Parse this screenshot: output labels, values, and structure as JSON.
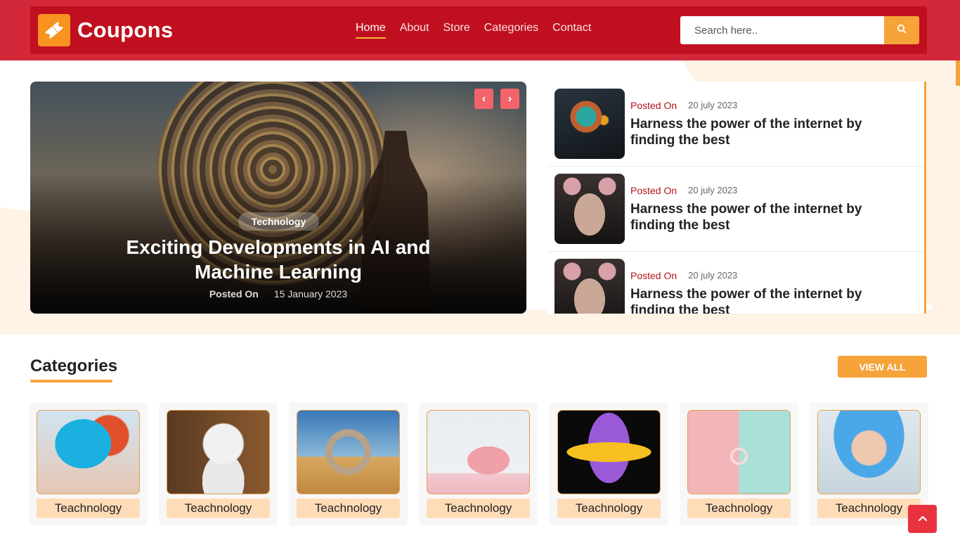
{
  "brand": {
    "name": "Coupons",
    "accent": "#f7931e",
    "primary": "#c0101f"
  },
  "nav": {
    "items": [
      {
        "label": "Home"
      },
      {
        "label": "About"
      },
      {
        "label": "Store"
      },
      {
        "label": "Categories"
      },
      {
        "label": "Contact"
      }
    ],
    "active": "Home"
  },
  "search": {
    "placeholder": "Search here..",
    "icon": "search-icon"
  },
  "hero": {
    "category": "Technology",
    "title": "Exciting Developments in AI and Machine Learning",
    "posted_label": "Posted On",
    "date": "15 January 2023",
    "prev_icon": "chevron-left-icon",
    "next_icon": "chevron-right-icon"
  },
  "posts": [
    {
      "posted_label": "Posted On",
      "date": "20 july 2023",
      "title": "Harness the power of the internet by finding the best"
    },
    {
      "posted_label": "Posted On",
      "date": "20 july 2023",
      "title": "Harness the power of the internet by finding the best"
    },
    {
      "posted_label": "Posted On",
      "date": "20 july 2023",
      "title": "Harness the power of the internet by finding the best"
    }
  ],
  "categories": {
    "heading": "Categories",
    "view_all": "VIEW ALL",
    "items": [
      {
        "label": "Teachnology"
      },
      {
        "label": "Teachnology"
      },
      {
        "label": "Teachnology"
      },
      {
        "label": "Teachnology"
      },
      {
        "label": "Teachnology"
      },
      {
        "label": "Teachnology"
      },
      {
        "label": "Teachnology"
      }
    ]
  },
  "back_to_top": {
    "icon": "chevron-up-icon"
  }
}
